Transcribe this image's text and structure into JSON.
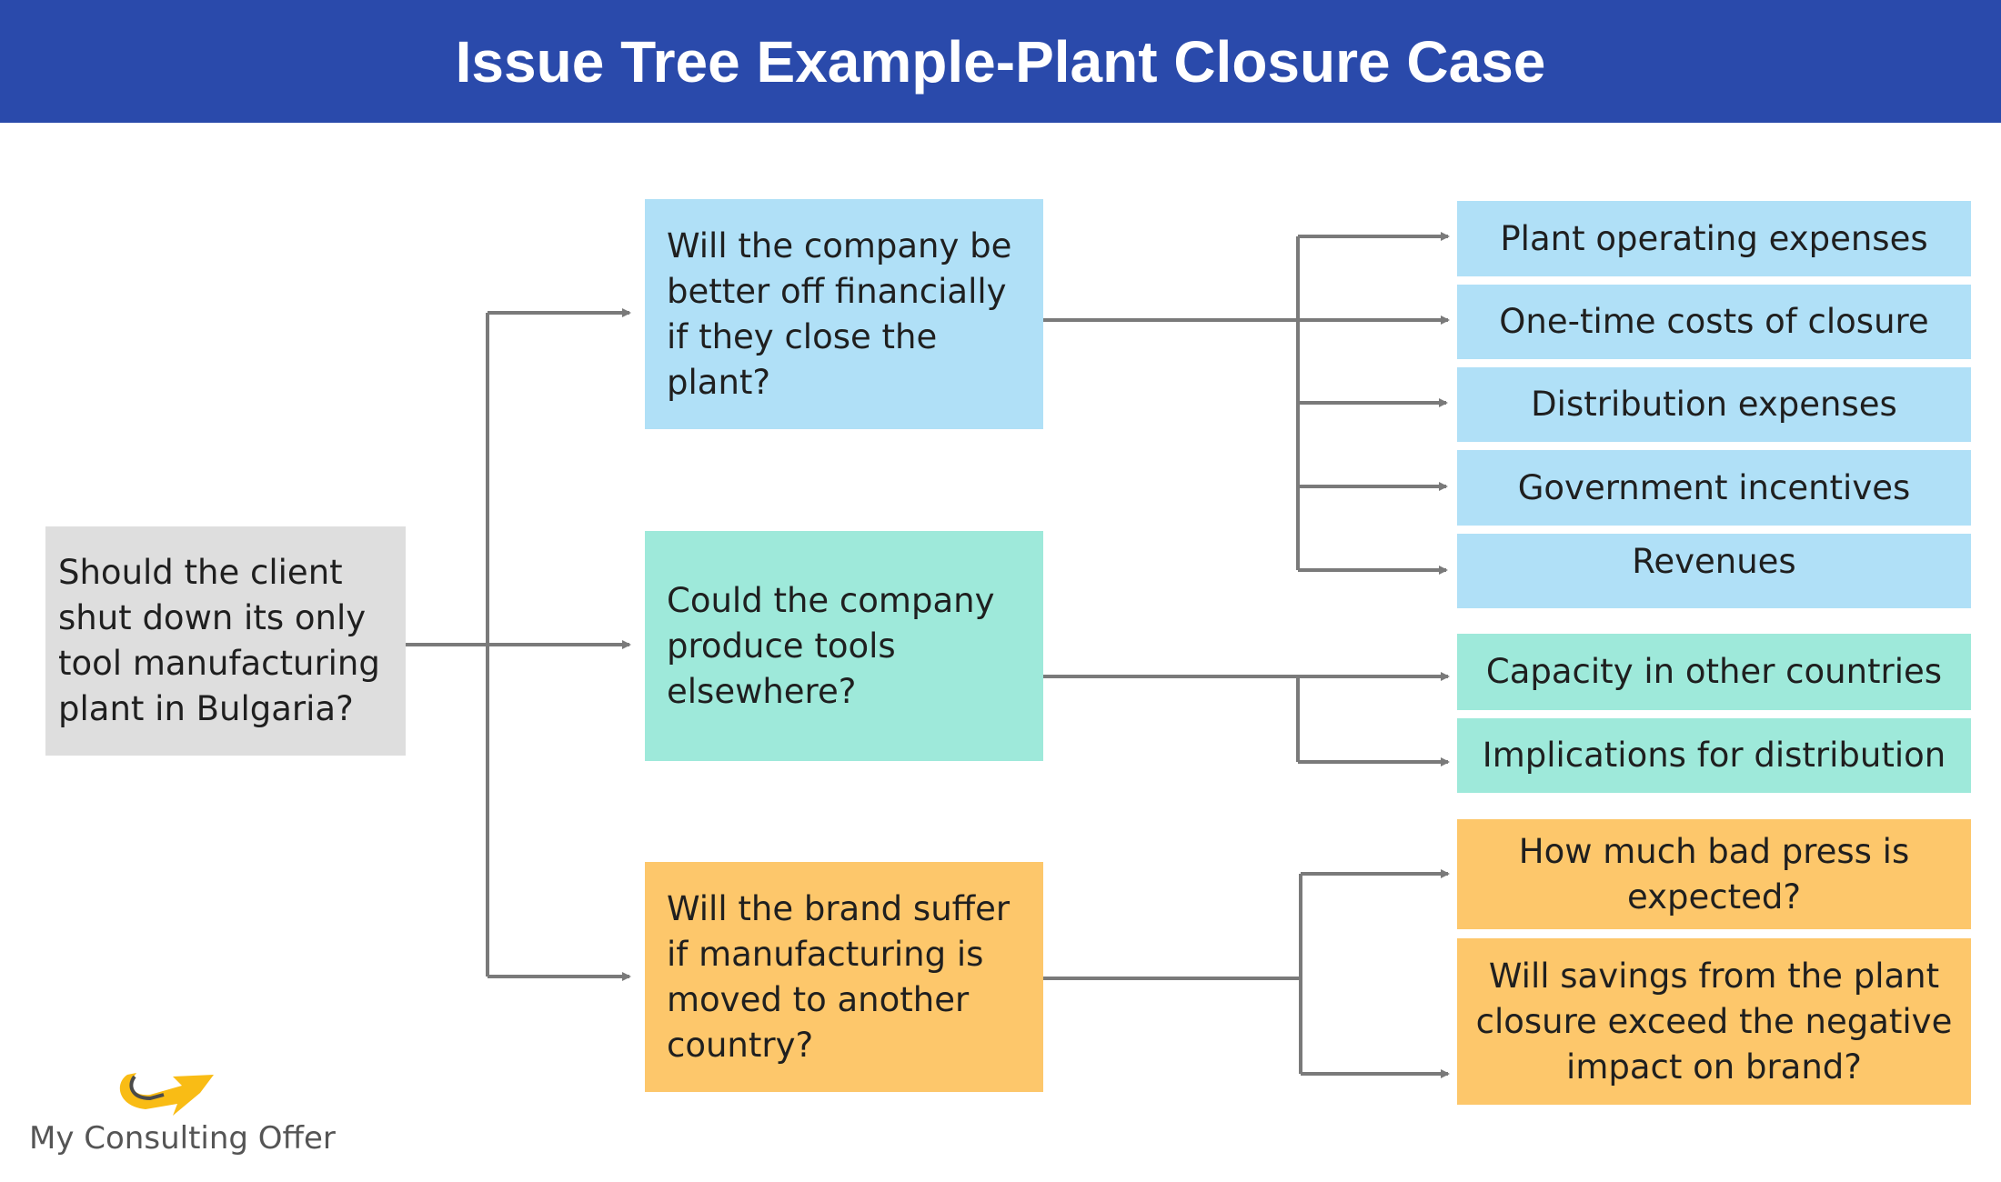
{
  "header": {
    "title": "Issue Tree Example-Plant Closure Case",
    "color": "#2a4aab"
  },
  "root": {
    "text": "Should the client shut down its only tool manufacturing plant in Bulgaria?",
    "color": "#dedede"
  },
  "branches": [
    {
      "text": "Will the company be better off financially if they close the plant?",
      "color": "#b0e0f7",
      "children": [
        "Plant operating expenses",
        "One-time costs of closure",
        "Distribution expenses",
        "Government incentives",
        "Revenues"
      ]
    },
    {
      "text": "Could the company produce tools elsewhere?",
      "color": "#9ee9da",
      "children": [
        "Capacity in other countries",
        "Implications for distribution"
      ]
    },
    {
      "text": "Will the brand suffer if manufacturing is moved to another country?",
      "color": "#fdc76b",
      "children": [
        "How much bad press is expected?",
        "Will savings from the plant closure exceed the negative impact on brand?"
      ]
    }
  ],
  "connector_color": "#7a7a7a",
  "logo": {
    "text": "My Consulting Offer",
    "icon": "arrow-logo-icon",
    "accent": "#f9bc15"
  }
}
